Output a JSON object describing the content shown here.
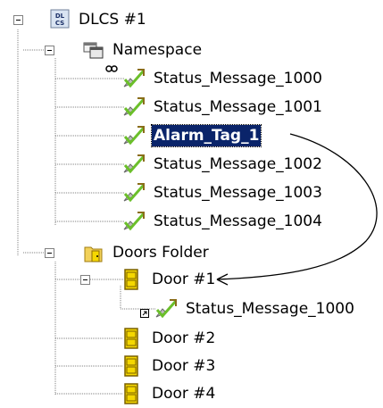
{
  "tree": {
    "root": {
      "label": "DLCS #1",
      "badge": "DL\nCS"
    },
    "namespace": {
      "label": "Namespace",
      "items": [
        {
          "label": "Status_Message_1000",
          "linked": true
        },
        {
          "label": "Status_Message_1001"
        },
        {
          "label": "Alarm_Tag_1",
          "selected": true
        },
        {
          "label": "Status_Message_1002"
        },
        {
          "label": "Status_Message_1003"
        },
        {
          "label": "Status_Message_1004"
        }
      ]
    },
    "doors_folder": {
      "label": "Doors Folder",
      "doors": [
        {
          "label": "Door #1",
          "children": [
            {
              "label": "Status_Message_1000",
              "shortcut": true
            }
          ]
        },
        {
          "label": "Door #2"
        },
        {
          "label": "Door #3"
        },
        {
          "label": "Door #4"
        }
      ]
    }
  },
  "colors": {
    "selection": "#0a246a",
    "door": "#f5d800",
    "tag_check": "#6bbf2a",
    "tree_line": "#808080"
  }
}
